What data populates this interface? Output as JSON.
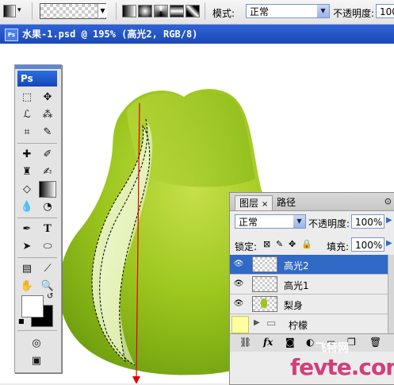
{
  "options_bar": {
    "mode_label": "模式:",
    "mode_value": "正常",
    "opacity_label": "不透明度:",
    "opacity_value": "100"
  },
  "document": {
    "title": "水果-1.psd @ 195% (高光2, RGB/8)",
    "app_badge": "Ps"
  },
  "toolbox": {
    "logo": "Ps",
    "tools": [
      "rect-marquee",
      "move",
      "lasso",
      "magic-wand",
      "crop",
      "slice",
      "healing",
      "brush",
      "clone-stamp",
      "history-brush",
      "eraser",
      "gradient",
      "blur",
      "dodge",
      "pen",
      "type",
      "path-select",
      "shape",
      "notes",
      "eyedropper",
      "hand",
      "zoom"
    ],
    "foreground_color": "#ffffff",
    "background_color": "#000000"
  },
  "layers_panel": {
    "tabs": [
      {
        "label": "图层"
      },
      {
        "label": "路径"
      }
    ],
    "blend_mode": "正常",
    "opacity_label": "不透明度:",
    "opacity_value": "100%",
    "lock_label": "锁定:",
    "fill_label": "填充:",
    "fill_value": "100%",
    "layers": [
      {
        "name": "高光2",
        "selected": true
      },
      {
        "name": "高光1",
        "selected": false
      },
      {
        "name": "梨身",
        "selected": false
      }
    ],
    "group": {
      "name": "柠檬"
    },
    "bottom_icons": [
      "link-icon",
      "fx-icon",
      "mask-icon",
      "adjustment-icon",
      "folder-icon",
      "new-layer-icon",
      "trash-icon"
    ]
  },
  "watermark": {
    "site": "fevte.com",
    "label": "飞特网"
  },
  "colors": {
    "pear_light": "#d8ec7a",
    "pear_dark": "#6f9f10",
    "guide_line": "#e00000",
    "selection_blue": "#3169c6"
  }
}
